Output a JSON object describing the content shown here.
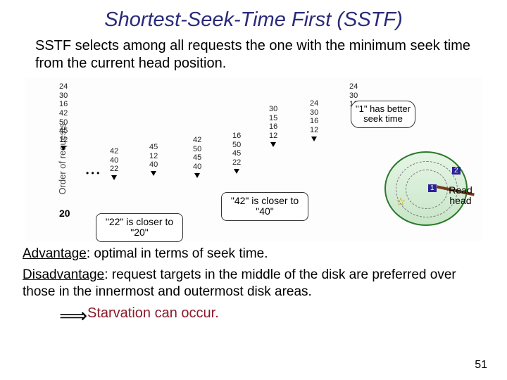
{
  "title": "Shortest-Seek-Time First (SSTF)",
  "intro": "SSTF selects among all requests the one with the minimum seek time from the current head position.",
  "diagram": {
    "ylabel": "Order of requests",
    "stages": {
      "s0": "24\n30\n16\n42\n50\n45\n12",
      "s1": "42\n40\n22",
      "s2": "45\n12\n40",
      "s3": "42\n50\n45\n40",
      "s4": "16\n50\n45\n22",
      "s5": "30\n15\n16\n12",
      "s6": "24\n30\n16\n12",
      "s7": "24\n30\n16"
    },
    "dots": "• • •",
    "last_value": "20",
    "callout1": "\"22\" is closer to \"20\"",
    "callout2": "\"42\" is closer to \"40\"",
    "bubble": "\"1\" has better seek time",
    "tag1": "1",
    "tag2": "2",
    "read_head": "Read head"
  },
  "advantage_label": "Advantage",
  "advantage_text": ": optimal in terms of seek time.",
  "disadvantage_label": "Disadvantage",
  "disadvantage_text": ": request targets in the middle of the disk are preferred over those in the innermost and outermost disk areas.",
  "starvation": "Starvation can occur.",
  "page_number": "51"
}
